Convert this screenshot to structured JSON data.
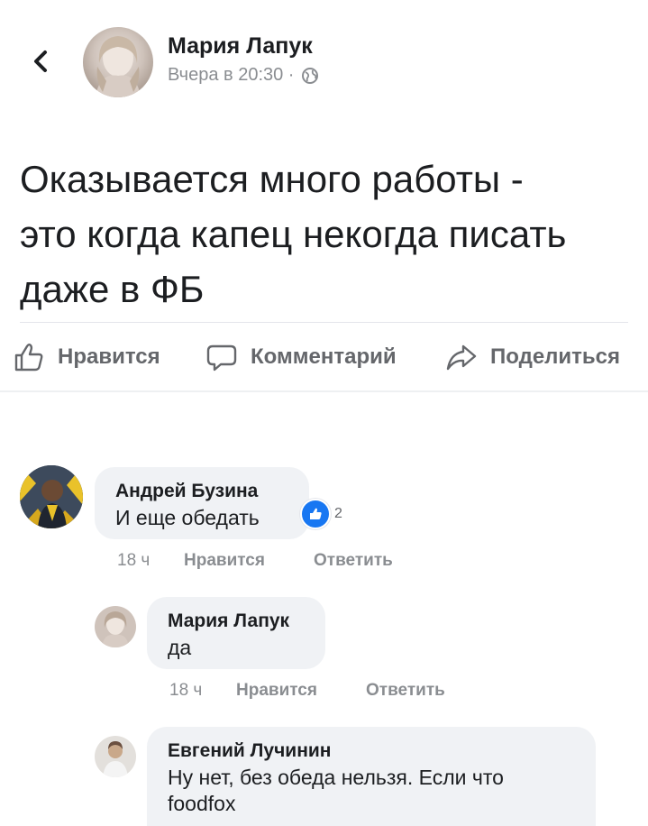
{
  "post": {
    "author": "Мария Лапук",
    "meta": "Вчера в 20:30 ·",
    "text_line1": "Оказывается много работы -",
    "text_line2": "это когда капец некогда писать",
    "text_line3": "даже в ФБ"
  },
  "icons": {
    "back": "chevron-left-icon",
    "privacy": "globe-icon",
    "like": "thumbs-up-icon",
    "comment": "speech-bubble-icon",
    "share": "share-arrow-icon"
  },
  "actions": {
    "like_label": "Нравится",
    "comment_label": "Комментарий",
    "share_label": "Поделиться"
  },
  "comments": [
    {
      "author": "Андрей Бузина",
      "text": "И еще обедать",
      "time": "18 ч",
      "like_label": "Нравится",
      "reply_label": "Ответить",
      "reactions": "2"
    },
    {
      "author": "Мария Лапук",
      "text": "да",
      "time": "18 ч",
      "like_label": "Нравится",
      "reply_label": "Ответить"
    },
    {
      "author": "Евгений Лучинин",
      "text_line1": "Ну нет, без обеда нельзя. Если что",
      "text_line2": "foodfox"
    }
  ],
  "colors": {
    "accent": "#1877f2",
    "bubble_bg": "#f0f2f5",
    "secondary_text": "#65676b",
    "meta_text": "#8a8d91"
  }
}
